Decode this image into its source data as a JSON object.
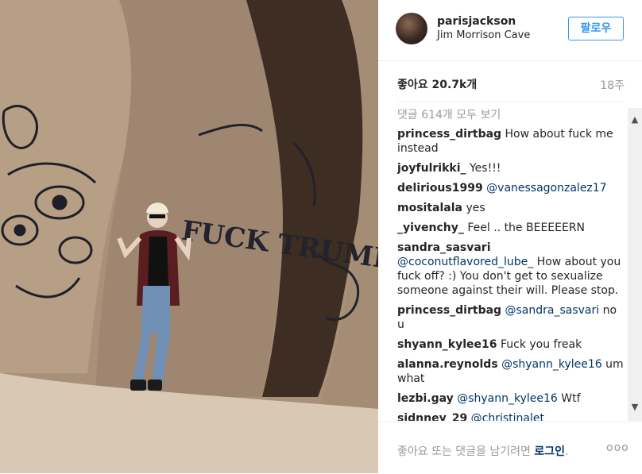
{
  "photo": {
    "graffiti_text": "FUCK TRUMP"
  },
  "header": {
    "username": "parisjackson",
    "location": "Jim Morrison Cave",
    "follow_label": "팔로우"
  },
  "stats": {
    "likes": "좋아요 20.7k개",
    "time_ago": "18주"
  },
  "view_all_comments": "댓글 614개 모두 보기",
  "comments": [
    {
      "user": "princess_dirtbag",
      "mention": "",
      "text": "How about fuck me instead"
    },
    {
      "user": "joyfulrikki_",
      "mention": "",
      "text": "Yes!!!"
    },
    {
      "user": "delirious1999",
      "mention": "@vanessagonzalez17",
      "text": ""
    },
    {
      "user": "mositalala",
      "mention": "",
      "text": "yes"
    },
    {
      "user": "_yivenchy_",
      "mention": "",
      "text": "Feel .. the BEEEEERN"
    },
    {
      "user": "sandra_sasvari",
      "mention": "@coconutflavored_lube_",
      "text": "How about you fuck off? :) You don't get to sexualize someone against their will. Please stop."
    },
    {
      "user": "princess_dirtbag",
      "mention": "@sandra_sasvari",
      "text": "no u"
    },
    {
      "user": "shyann_kylee16",
      "mention": "",
      "text": "Fuck you freak"
    },
    {
      "user": "alanna.reynolds",
      "mention": "@shyann_kylee16",
      "text": "um what"
    },
    {
      "user": "lezbi.gay",
      "mention": "@shyann_kylee16",
      "text": "Wtf"
    },
    {
      "user": "sidnney_29",
      "mention": "@christinalet",
      "text": ""
    }
  ],
  "footer": {
    "prompt": "좋아요 또는 댓글을 남기려면",
    "login_label": "로그인",
    "more_label": "ooo"
  }
}
